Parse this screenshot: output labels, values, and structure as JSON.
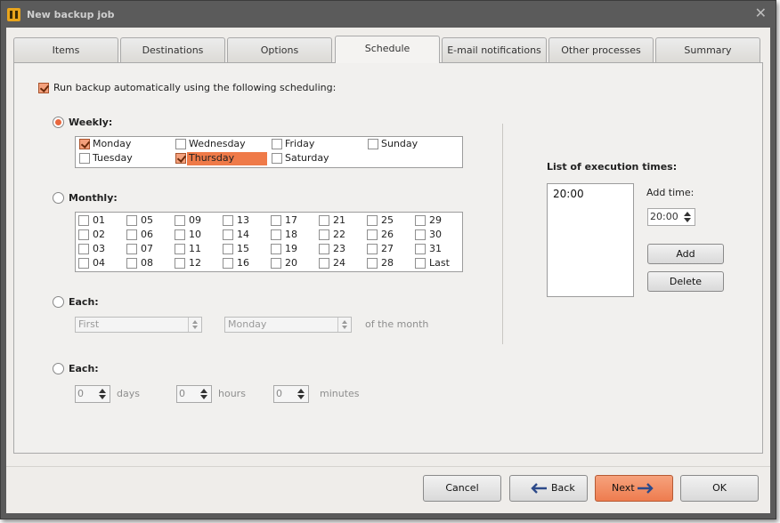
{
  "window": {
    "title": "New backup job"
  },
  "tabs": [
    "Items",
    "Destinations",
    "Options",
    "Schedule",
    "E-mail notifications",
    "Other processes",
    "Summary"
  ],
  "active_tab": "Schedule",
  "schedule": {
    "auto_label": "Run backup automatically using the following scheduling:",
    "auto_checked": true,
    "weekly": {
      "label": "Weekly:",
      "selected": true,
      "days": [
        {
          "name": "Monday",
          "checked": true
        },
        {
          "name": "Wednesday",
          "checked": false
        },
        {
          "name": "Friday",
          "checked": false
        },
        {
          "name": "Sunday",
          "checked": false
        },
        {
          "name": "Tuesday",
          "checked": false
        },
        {
          "name": "Thursday",
          "checked": true,
          "highlighted": true
        },
        {
          "name": "Saturday",
          "checked": false
        }
      ]
    },
    "monthly": {
      "label": "Monthly:",
      "selected": false,
      "days": [
        "01",
        "05",
        "09",
        "13",
        "17",
        "21",
        "25",
        "29",
        "02",
        "06",
        "10",
        "14",
        "18",
        "22",
        "26",
        "30",
        "03",
        "07",
        "11",
        "15",
        "19",
        "23",
        "27",
        "31",
        "04",
        "08",
        "12",
        "16",
        "20",
        "24",
        "28",
        "Last"
      ]
    },
    "each_month": {
      "label": "Each:",
      "selected": false,
      "ordinal": "First",
      "weekday": "Monday",
      "suffix": "of the month"
    },
    "each_interval": {
      "label": "Each:",
      "selected": false,
      "days_value": "0",
      "days_label": "days",
      "hours_value": "0",
      "hours_label": "hours",
      "minutes_value": "0",
      "minutes_label": "minutes"
    },
    "execution": {
      "title": "List of execution times:",
      "times": [
        "20:00"
      ],
      "add_time_label": "Add time:",
      "add_time_value": "20:00",
      "add_button": "Add",
      "delete_button": "Delete"
    }
  },
  "footer": {
    "cancel": "Cancel",
    "back": "Back",
    "next": "Next",
    "ok": "OK"
  },
  "colors": {
    "accent": "#ef7a48",
    "title_bar": "#5b5b5b"
  }
}
